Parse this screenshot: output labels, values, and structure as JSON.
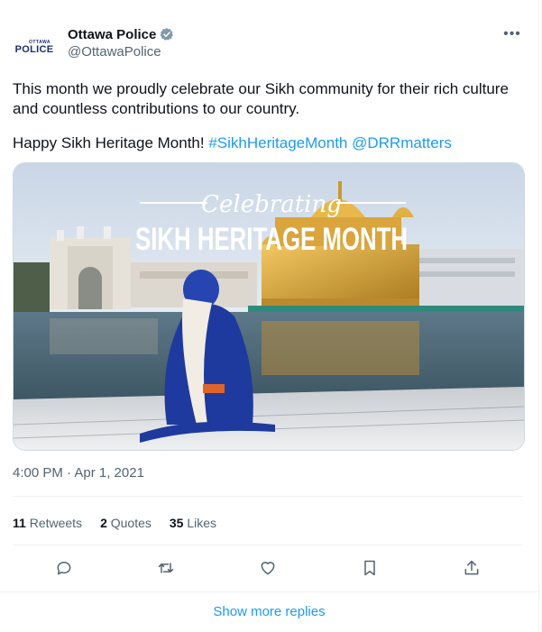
{
  "author": {
    "avatar_top": "OTTAWA",
    "avatar_main": "POLICE",
    "display_name": "Ottawa Police",
    "handle": "@OttawaPolice",
    "verified": true
  },
  "more_icon": "more-horizontal-icon",
  "tweet": {
    "line1": "This month we proudly celebrate our Sikh community for their rich culture and countless contributions to our country.",
    "line2_prefix": "Happy Sikh Heritage Month! ",
    "hashtag": "#SikhHeritageMonth",
    "mention": "@DRRmatters"
  },
  "media": {
    "overlay_script": "Celebrating",
    "overlay_title": "SIKH HERITAGE MONTH"
  },
  "timestamp": "4:00 PM · Apr 1, 2021",
  "stats": {
    "retweets_count": "11",
    "retweets_label": "Retweets",
    "quotes_count": "2",
    "quotes_label": "Quotes",
    "likes_count": "35",
    "likes_label": "Likes"
  },
  "actions": [
    "reply-icon",
    "retweet-icon",
    "like-icon",
    "bookmark-icon",
    "share-icon"
  ],
  "show_more": "Show more replies",
  "colors": {
    "accent": "#1d9bf0",
    "secondary_text": "#536471",
    "verified": "#829aab"
  }
}
